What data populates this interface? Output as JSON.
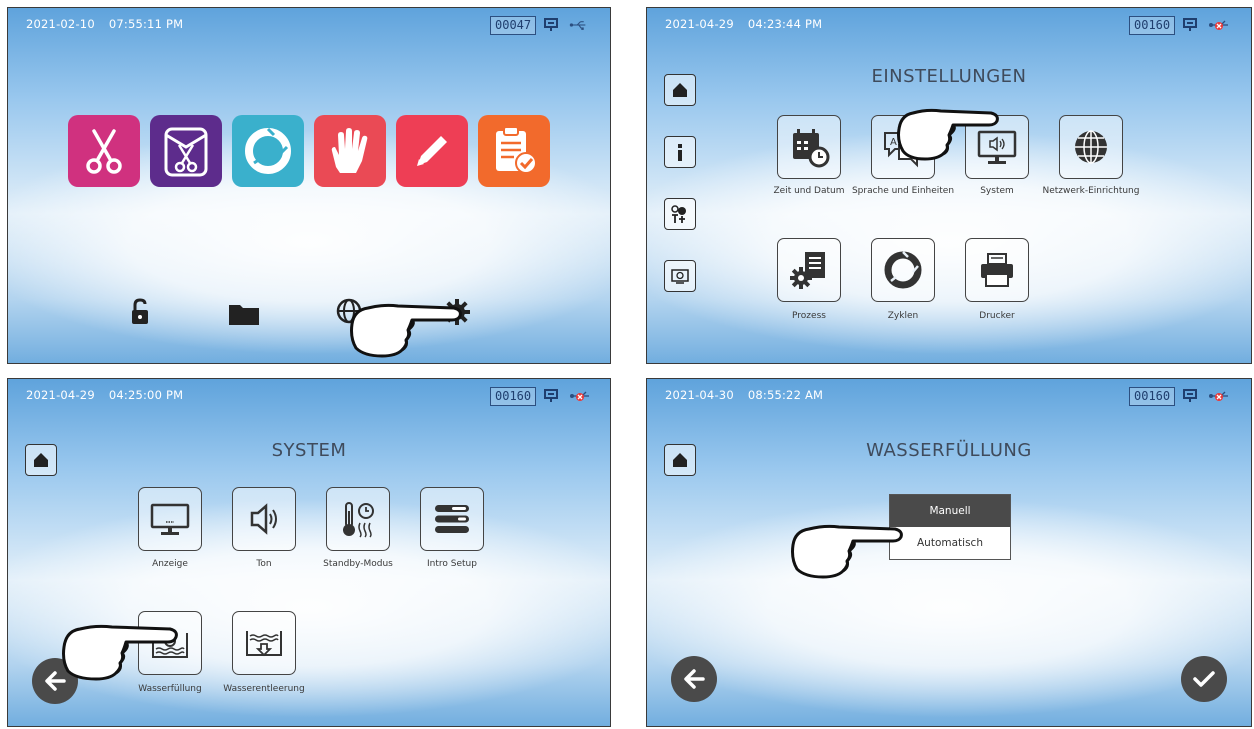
{
  "panel1": {
    "date": "2021-02-10",
    "time": "07:55:11 PM",
    "counter": "00047",
    "status_icons": [
      "display-icon",
      "usb-icon"
    ],
    "app_tiles": [
      {
        "name": "instruments-tile",
        "icon": "scissors-icon",
        "color": "#d0317f"
      },
      {
        "name": "pouched-instruments-tile",
        "icon": "pouch-scissors-icon",
        "color": "#5d2c8c"
      },
      {
        "name": "cycle-tile",
        "icon": "cycle-icon",
        "color": "#3ab0cc"
      },
      {
        "name": "gloves-tile",
        "icon": "glove-icon",
        "color": "#ea4a55"
      },
      {
        "name": "edit-tile",
        "icon": "pencil-icon",
        "color": "#ee3e55"
      },
      {
        "name": "protocol-tile",
        "icon": "clipboard-check-icon",
        "color": "#f26a2c"
      }
    ],
    "bottom_icons": [
      "unlock-icon",
      "folder-icon",
      "globe-icon",
      "gear-icon"
    ]
  },
  "panel2": {
    "date": "2021-04-29",
    "time": "04:23:44 PM",
    "counter": "00160",
    "title": "EINSTELLUNGEN",
    "side_icons": [
      "home-icon",
      "info-icon",
      "service-tools-icon",
      "monitor-icon"
    ],
    "tiles": [
      {
        "icon": "calendar-clock-icon",
        "label": "Zeit und Datum"
      },
      {
        "icon": "language-icon",
        "label": "Sprache und Einheiten"
      },
      {
        "icon": "system-monitor-icon",
        "label": "System"
      },
      {
        "icon": "network-globe-icon",
        "label": "Netzwerk-Einrichtung"
      },
      {
        "icon": "process-gear-icon",
        "label": "Prozess"
      },
      {
        "icon": "cycles-icon",
        "label": "Zyklen"
      },
      {
        "icon": "printer-icon",
        "label": "Drucker"
      }
    ]
  },
  "panel3": {
    "date": "2021-04-29",
    "time": "04:25:00 PM",
    "counter": "00160",
    "title": "SYSTEM",
    "tiles": [
      {
        "icon": "display-monitor-icon",
        "label": "Anzeige"
      },
      {
        "icon": "speaker-icon",
        "label": "Ton"
      },
      {
        "icon": "standby-thermometer-icon",
        "label": "Standby-Modus"
      },
      {
        "icon": "intro-setup-icon",
        "label": "Intro Setup"
      },
      {
        "icon": "water-fill-icon",
        "label": "Wasserfüllung"
      },
      {
        "icon": "water-drain-icon",
        "label": "Wasserentleerung"
      }
    ]
  },
  "panel4": {
    "date": "2021-04-30",
    "time": "08:55:22 AM",
    "counter": "00160",
    "title": "WASSERFÜLLUNG",
    "options": [
      "Manuell",
      "Automatisch"
    ],
    "selected_option": "Manuell"
  }
}
